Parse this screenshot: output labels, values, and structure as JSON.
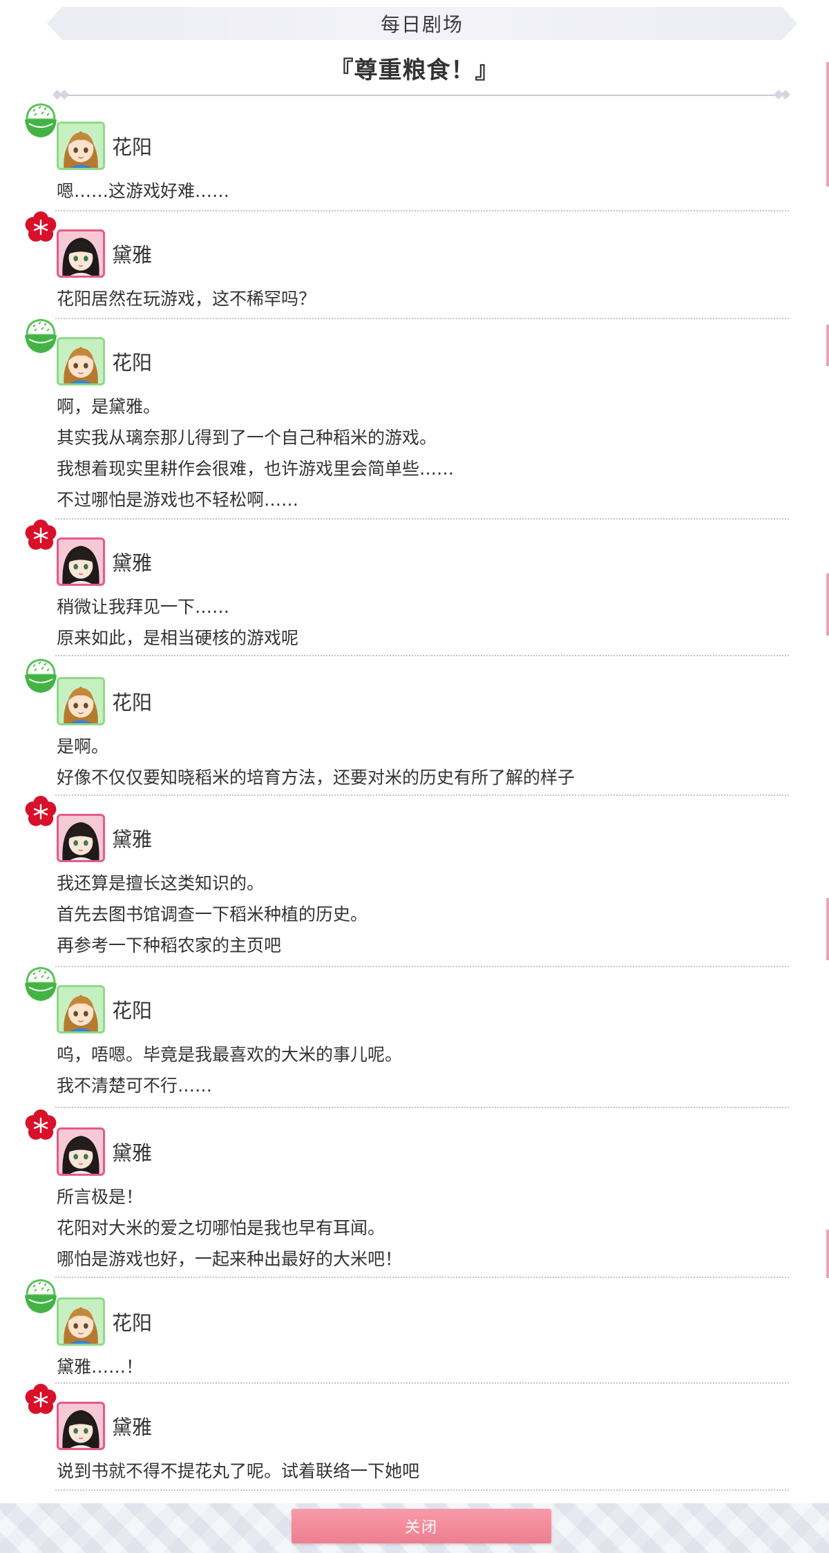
{
  "header": {
    "banner": "每日剧场",
    "title": "『尊重粮食！』"
  },
  "messages": [
    {
      "speaker": "花阳",
      "character": "hanayo",
      "badge_icon": "rice-bowl-icon",
      "lines": [
        "嗯……这游戏好难……"
      ]
    },
    {
      "speaker": "黛雅",
      "character": "daiya",
      "badge_icon": "red-flower-icon",
      "lines": [
        "花阳居然在玩游戏，这不稀罕吗？"
      ]
    },
    {
      "speaker": "花阳",
      "character": "hanayo",
      "badge_icon": "rice-bowl-icon",
      "lines": [
        "啊，是黛雅。",
        "其实我从璃奈那儿得到了一个自己种稻米的游戏。",
        "我想着现实里耕作会很难，也许游戏里会简单些……",
        "不过哪怕是游戏也不轻松啊……"
      ]
    },
    {
      "speaker": "黛雅",
      "character": "daiya",
      "badge_icon": "red-flower-icon",
      "lines": [
        "稍微让我拜见一下……",
        "原来如此，是相当硬核的游戏呢"
      ]
    },
    {
      "speaker": "花阳",
      "character": "hanayo",
      "badge_icon": "rice-bowl-icon",
      "lines": [
        "是啊。",
        "好像不仅仅要知晓稻米的培育方法，还要对米的历史有所了解的样子"
      ]
    },
    {
      "speaker": "黛雅",
      "character": "daiya",
      "badge_icon": "red-flower-icon",
      "lines": [
        "我还算是擅长这类知识的。",
        "首先去图书馆调查一下稻米种植的历史。",
        "再参考一下种稻农家的主页吧"
      ]
    },
    {
      "speaker": "花阳",
      "character": "hanayo",
      "badge_icon": "rice-bowl-icon",
      "lines": [
        "呜，唔嗯。毕竟是我最喜欢的大米的事儿呢。",
        "我不清楚可不行……"
      ]
    },
    {
      "speaker": "黛雅",
      "character": "daiya",
      "badge_icon": "red-flower-icon",
      "lines": [
        "所言极是！",
        "花阳对大米的爱之切哪怕是我也早有耳闻。",
        "哪怕是游戏也好，一起来种出最好的大米吧！"
      ]
    },
    {
      "speaker": "花阳",
      "character": "hanayo",
      "badge_icon": "rice-bowl-icon",
      "lines": [
        "黛雅……！"
      ]
    },
    {
      "speaker": "黛雅",
      "character": "daiya",
      "badge_icon": "red-flower-icon",
      "lines": [
        "说到书就不得不提花丸了呢。试着联络一下她吧"
      ]
    }
  ],
  "footer": {
    "close_label": "关闭"
  },
  "colors": {
    "hanayo_frame": "#8fd98a",
    "daiya_frame": "#e85a85",
    "close_button": "#f28a9a"
  }
}
